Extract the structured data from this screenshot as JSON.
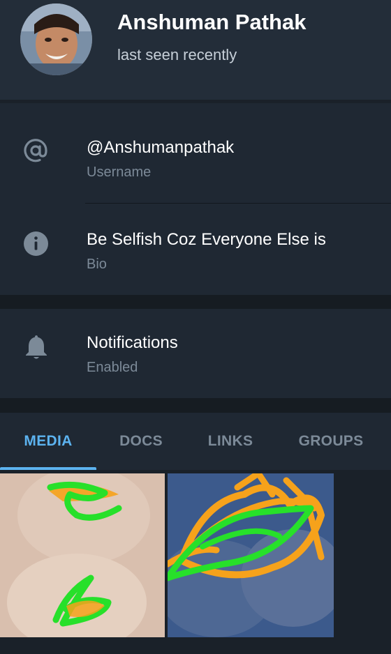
{
  "profile": {
    "name": "Anshuman Pathak",
    "status": "last seen recently"
  },
  "info": {
    "username": {
      "value": "@Anshumanpathak",
      "label": "Username",
      "icon": "at-icon"
    },
    "bio": {
      "value": "Be Selfish Coz Everyone Else is",
      "label": "Bio",
      "icon": "info-icon"
    }
  },
  "notifications": {
    "title": "Notifications",
    "status": "Enabled",
    "icon": "bell-icon"
  },
  "tabs": [
    {
      "label": "MEDIA",
      "active": true
    },
    {
      "label": "DOCS",
      "active": false
    },
    {
      "label": "LINKS",
      "active": false
    },
    {
      "label": "GROUPS",
      "active": false
    }
  ],
  "colors": {
    "accent": "#5cb3f0",
    "background": "#1a2129",
    "card": "#1f2833",
    "header": "#232d39",
    "secondary_text": "#7c8a98"
  }
}
